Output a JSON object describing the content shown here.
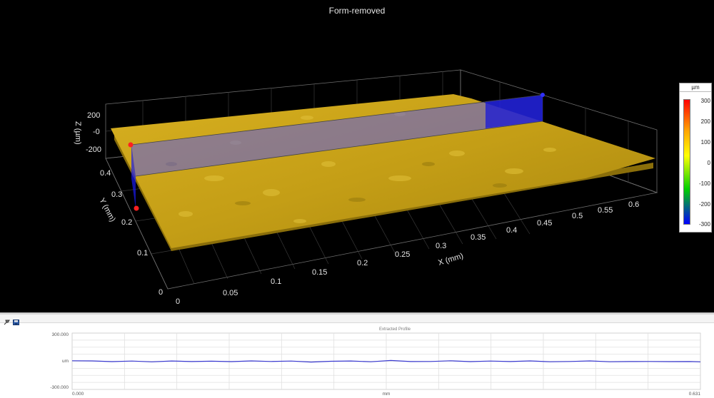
{
  "view3d": {
    "title": "Form-removed",
    "x_axis": {
      "label": "X (mm)",
      "ticks": [
        "0",
        "0.05",
        "0.1",
        "0.15",
        "0.2",
        "0.25",
        "0.3",
        "0.35",
        "0.4",
        "0.45",
        "0.5",
        "0.55",
        "0.6"
      ]
    },
    "y_axis": {
      "label": "Y (mm)",
      "ticks": [
        "0",
        "0.1",
        "0.2",
        "0.3",
        "0.4"
      ]
    },
    "z_axis": {
      "label": "Z (µm)",
      "ticks": [
        "200",
        "-0",
        "-200"
      ]
    },
    "surface_color": "#c8a418",
    "section_plane_color": "#5a5ae6",
    "colors": {
      "background": "#000000",
      "grid": "#6e6e6e",
      "marker_red": "#ff2020",
      "marker_blue": "#3030ff"
    }
  },
  "colorbar": {
    "unit": "µm",
    "ticks": [
      "300",
      "200",
      "100",
      "0",
      "-100",
      "-200",
      "-300"
    ]
  },
  "profile_panel": {
    "toolbar": {
      "pin_icon": "pin-icon",
      "save_icon": "save-icon"
    },
    "chart_data": {
      "type": "line",
      "title": "Extracted Profile",
      "xlabel": "mm",
      "ylabel": "um",
      "x_tick_labels": {
        "start": "0.000",
        "end": "0.631"
      },
      "y_tick_labels": {
        "top": "300.000",
        "bottom": "-300.000"
      },
      "xlim": [
        0,
        0.631
      ],
      "ylim": [
        -300,
        300
      ],
      "grid": true,
      "series": [
        {
          "color": "#3a3ad0",
          "x": [
            0,
            0.02,
            0.04,
            0.06,
            0.08,
            0.1,
            0.12,
            0.14,
            0.16,
            0.18,
            0.2,
            0.22,
            0.24,
            0.26,
            0.28,
            0.3,
            0.32,
            0.34,
            0.36,
            0.38,
            0.4,
            0.42,
            0.44,
            0.46,
            0.48,
            0.5,
            0.52,
            0.54,
            0.56,
            0.58,
            0.6,
            0.62,
            0.631
          ],
          "y": [
            5,
            4,
            -4,
            2,
            -6,
            3,
            -3,
            1,
            -4,
            4,
            -2,
            2,
            -8,
            0,
            3,
            -5,
            8,
            -3,
            -2,
            5,
            -4,
            2,
            -3,
            4,
            -5,
            -2,
            4,
            -5,
            -3,
            -2,
            -4,
            -3,
            -6
          ]
        }
      ]
    }
  }
}
